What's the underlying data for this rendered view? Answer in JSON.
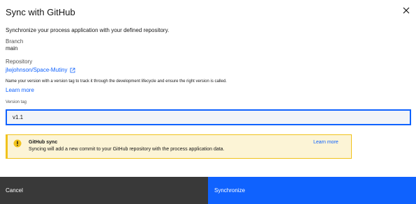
{
  "modal": {
    "title": "Sync with GitHub",
    "description": "Synchronize your process application with your defined repository.",
    "close_icon": "close-icon"
  },
  "branch": {
    "label": "Branch",
    "value": "main"
  },
  "repository": {
    "label": "Repository",
    "link_text": "jlwjohnson/Space-Mutiny",
    "link_icon": "launch-icon"
  },
  "version_help": {
    "text": "Name your version with a version tag to track it through the development lifecycle and ensure the right version is called.",
    "learn_more": "Learn more"
  },
  "version_tag": {
    "label": "Version tag",
    "value": "v1.1"
  },
  "notification": {
    "icon": "warning-icon",
    "title": "GitHub sync",
    "text": "Syncing will add a new commit to your GitHub repository with the process application data.",
    "learn_more": "Learn more",
    "background": "#fcf4d6",
    "accent": "#f1c21b"
  },
  "footer": {
    "cancel_label": "Cancel",
    "primary_label": "Synchronize"
  },
  "colors": {
    "primary": "#0f62fe",
    "secondary": "#393939",
    "link": "#0f62fe"
  }
}
